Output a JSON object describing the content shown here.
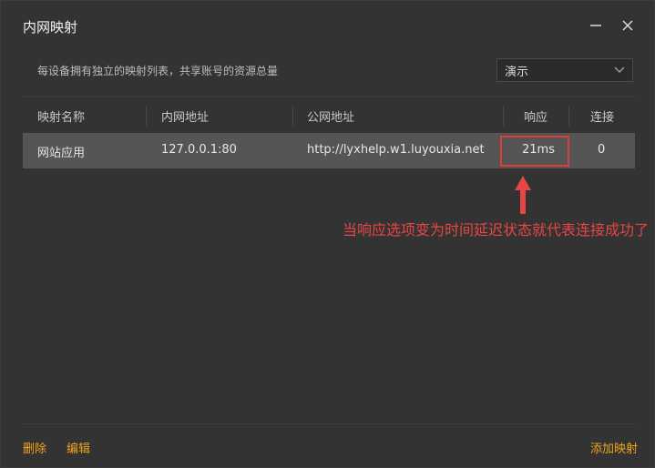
{
  "window": {
    "title": "内网映射",
    "minimize_icon": "minimize-icon",
    "close_icon": "close-icon"
  },
  "description": "每设备拥有独立的映射列表，共享账号的资源总量",
  "device_select": {
    "value": "演示"
  },
  "table": {
    "headers": [
      "映射名称",
      "内网地址",
      "公网地址",
      "响应",
      "连接"
    ],
    "rows": [
      {
        "name": "网站应用",
        "local": "127.0.0.1:80",
        "public": "http://lyxhelp.w1.luyouxia.net",
        "response": "21ms",
        "connections": "0"
      }
    ]
  },
  "annotation": "当响应选项变为时间延迟状态就代表连接成功了",
  "footer": {
    "delete_label": "删除",
    "edit_label": "编辑",
    "add_label": "添加映射"
  },
  "colors": {
    "accent": "#f0a51a",
    "annotation": "#e84545",
    "row_selected": "#555555",
    "background": "#333333"
  }
}
